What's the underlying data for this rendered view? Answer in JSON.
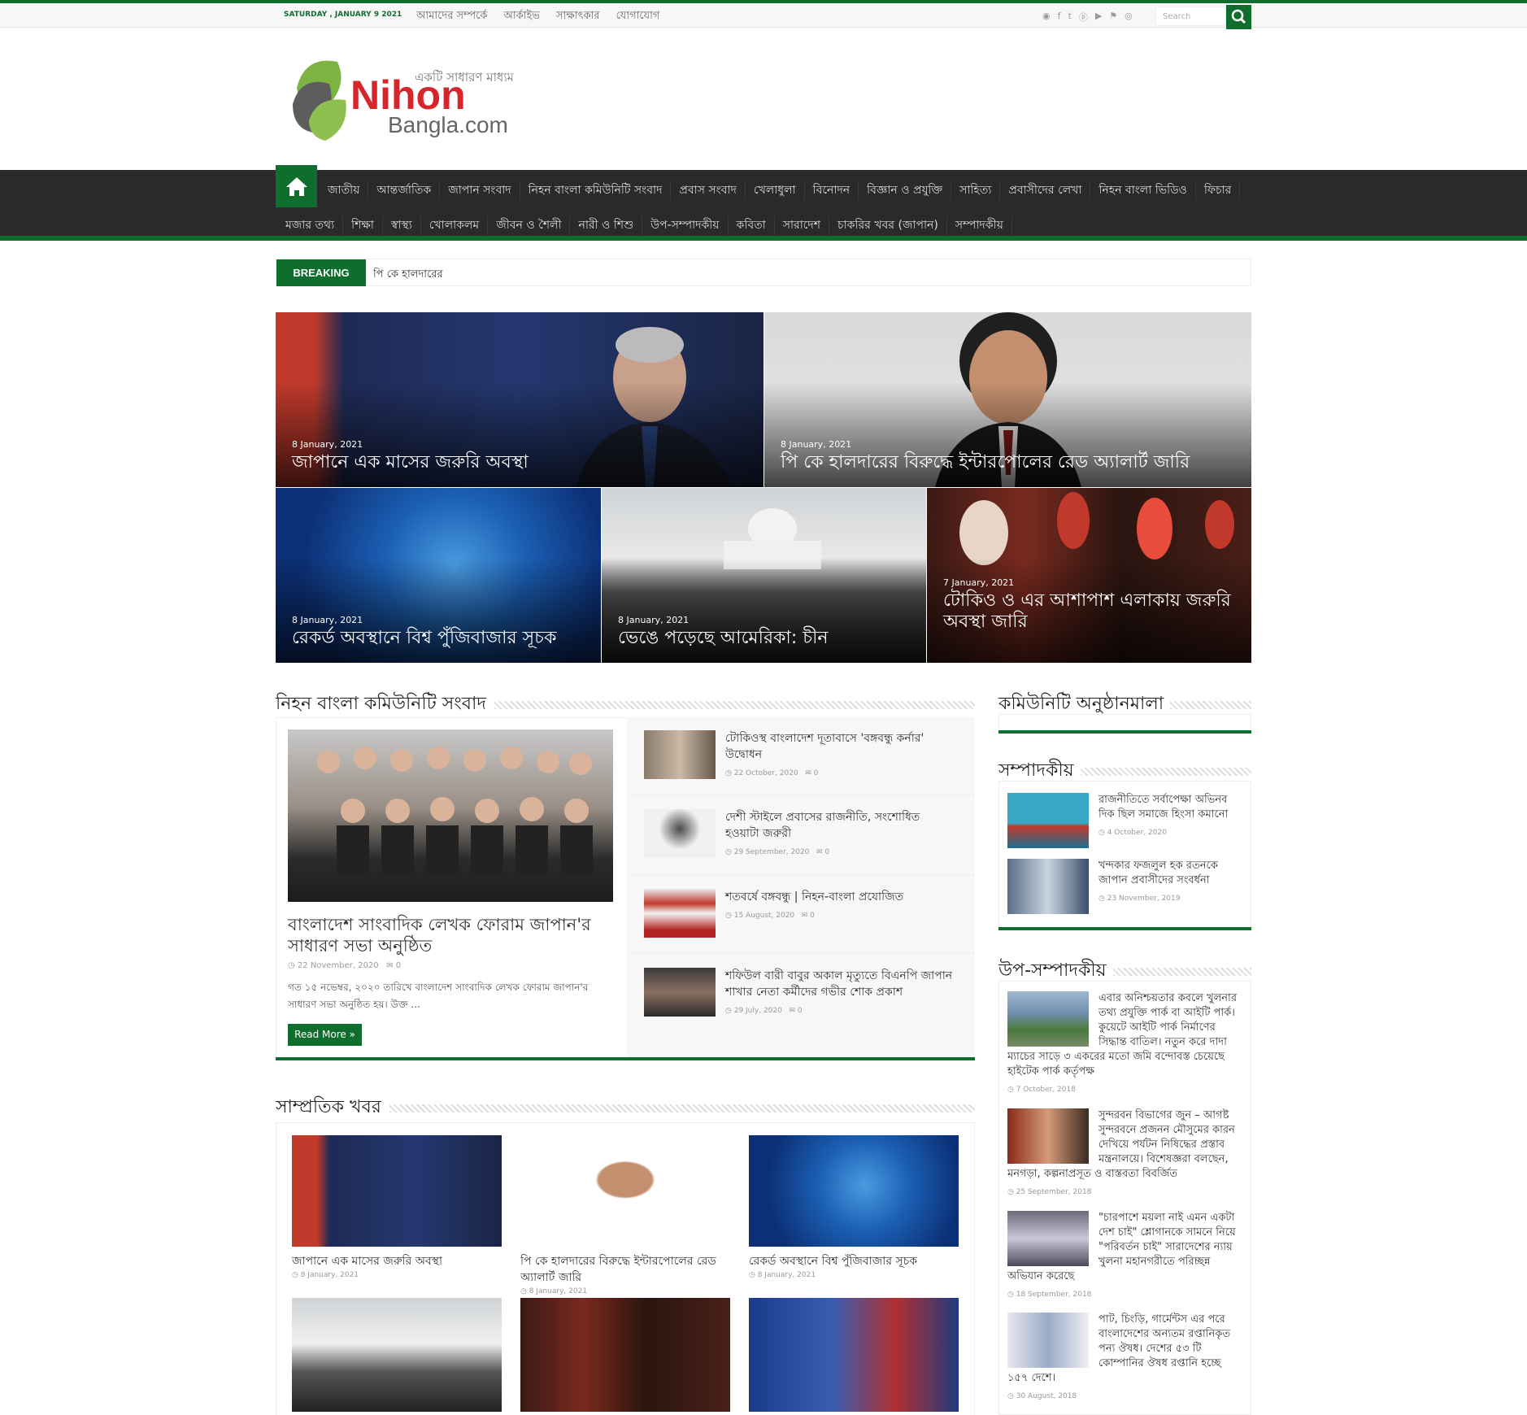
{
  "topbar": {
    "date": "SATURDAY , JANUARY 9 2021",
    "links": [
      "আমাদের সম্পর্কে",
      "আর্কাইভ",
      "সাক্ষাৎকার",
      "যোগাযোগ"
    ],
    "social_icons": [
      "rss-icon",
      "facebook-icon",
      "twitter-icon",
      "pinterest-icon",
      "youtube-icon",
      "foursquare-icon",
      "instagram-icon"
    ],
    "search_placeholder": "Search"
  },
  "logo": {
    "tagline": "একটি সাধারণ মাধ্যম",
    "name_main": "Nihon",
    "name_sub": "Bangla.com"
  },
  "nav": {
    "row1": [
      "জাতীয়",
      "আন্তর্জাতিক",
      "জাপান সংবাদ",
      "নিহন বাংলা কমিউনিটি সংবাদ",
      "প্রবাস সংবাদ",
      "খেলাধুলা",
      "বিনোদন",
      "বিজ্ঞান ও প্রযুক্তি",
      "সাহিত্য",
      "প্রবাসীদের লেখা",
      "নিহন বাংলা ভিডিও",
      "ফিচার"
    ],
    "row2": [
      "মজার তথ্য",
      "শিক্ষা",
      "স্বাস্থ্য",
      "খোলাকলম",
      "জীবন ও শৈলী",
      "নারী ও শিশু",
      "উপ-সম্পাদকীয়",
      "কবিতা",
      "সারাদেশ",
      "চাকরির খবর (জাপান)",
      "সম্পাদকীয়"
    ]
  },
  "breaking": {
    "label": "BREAKING NEWS",
    "text": "পি কে হালদারের"
  },
  "slider": [
    {
      "date": "8 January, 2021",
      "title": "জাপানে এক মাসের জরুরি অবস্থা"
    },
    {
      "date": "8 January, 2021",
      "title": "পি কে হালদারের বিরুদ্ধে ইন্টারপোলের রেড অ্যালার্ট জারি"
    },
    {
      "date": "8 January, 2021",
      "title": "রেকর্ড অবস্থানে বিশ্ব পুঁজিবাজার সূচক"
    },
    {
      "date": "8 January, 2021",
      "title": "ভেঙে পড়েছে আমেরিকা: চীন"
    },
    {
      "date": "7 January, 2021",
      "title": "টোকিও ও এর আশাপাশ এলাকায় জরুরি অবস্থা জারি"
    }
  ],
  "community": {
    "heading": "নিহন বাংলা কমিউনিটি সংবাদ",
    "main": {
      "title": "বাংলাদেশ সাংবাদিক লেখক ফোরাম জাপান'র সাধারণ সভা অনুষ্ঠিত",
      "date": "22 November, 2020",
      "comments": "0",
      "excerpt": "গত ১৫ নভেম্বর, ২০২০ তারিখে বাংলাদেশ সাংবাদিক লেখক ফোরাম জাপান'র সাধারণ সভা অনুষ্ঠিত হয়। উক্ত ...",
      "read_more": "Read More »"
    },
    "items": [
      {
        "title": "টোকিওস্থ বাংলাদেশ দূতাবাসে 'বঙ্গবন্ধু কর্নার' উদ্বোধন",
        "date": "22 October, 2020",
        "comments": "0"
      },
      {
        "title": "দেশী স্টাইলে প্রবাসের রাজনীতি, সংশোধিত হওয়াটা জরুরী",
        "date": "29 September, 2020",
        "comments": "0"
      },
      {
        "title": "শতবর্ষে বঙ্গবন্ধু | নিহন-বাংলা প্রযোজিত",
        "date": "15 August, 2020",
        "comments": "0"
      },
      {
        "title": "শফিউল বারী বাবুর অকাল মৃত্যুতে বিএনপি জাপান শাখার নেতা কর্মীদের গভীর শোক প্রকাশ",
        "date": "29 July, 2020",
        "comments": "0"
      }
    ]
  },
  "recent": {
    "heading": "সাম্প্রতিক খবর",
    "items": [
      {
        "title": "জাপানে এক মাসের জরুরি অবস্থা",
        "date": "8 January, 2021"
      },
      {
        "title": "পি কে হালদারের বিরুদ্ধে ইন্টারপোলের রেড অ্যালার্ট জারি",
        "date": "8 January, 2021"
      },
      {
        "title": "রেকর্ড অবস্থানে বিশ্ব পুঁজিবাজার সূচক",
        "date": "8 January, 2021"
      }
    ]
  },
  "sidebar": {
    "events_heading": "কমিউনিটি অনুষ্ঠানমালা",
    "editorial_heading": "সম্পাদকীয়",
    "editorial": [
      {
        "title": "রাজনীতিতে সর্বাপেক্ষা অভিনব দিক ছিল সমাজে হিংসা কমানো",
        "date": "4 October, 2020"
      },
      {
        "title": "খন্দকার ফজলুল হক রতনকে জাপান প্রবাসীদের সংবর্ধনা",
        "date": "23 November, 2019"
      }
    ],
    "op_heading": "উপ-সম্পাদকীয়",
    "op": [
      {
        "title": "এবার অনিশ্চয়তার কবলে খুলনার তথ্য প্রযুক্তি পার্ক বা আইটি পার্ক। কুয়েটে আইটি পার্ক নির্মাণের সিদ্ধান্ত বাতিল। নতুন করে দাদা ম্যাচের সাড়ে ৩ একরের মতো জমি বন্দোবস্ত চেয়েছে হাইটেক পার্ক কর্তৃপক্ষ",
        "date": "7 October, 2018"
      },
      {
        "title": "সুন্দরবন বিভাগের জুন – আগষ্ট সুন্দরবনে প্রজনন মৌসুমের কারন দেখিয়ে পর্যটন নিষিদ্ধের প্রস্তাব মন্ত্রনালয়ে। বিশেষজ্ঞরা বলছেন, মনগড়া, কল্পনাপ্রসূত ও বাস্তবতা বিবর্জিত",
        "date": "25 September, 2018"
      },
      {
        "title": "\"চারপাশে ময়লা নাই এমন একটা দেশ চাই\" শ্লোগানকে সামনে নিয়ে \"পরিবর্তন চাই\" সারাদেশের ন্যায় খুলনা মহানগরীতে পরিচ্ছন্ন অভিযান করেছে",
        "date": "18 September, 2018"
      },
      {
        "title": "পাট, চিংড়ি, গার্মেন্টস এর পরে বাংলাদেশের অন্যতম রপ্তানিকৃত পন্য ঔষধ। দেশের ৫৩ টি কোম্পানির ঔষধ রপ্তানি হচ্ছে ১৫৭ দেশে।",
        "date": "30 August, 2018"
      }
    ]
  },
  "colors": {
    "brand": "#0f6e2e",
    "nav_bg": "#2a2a2a",
    "logo_red": "#d7262b"
  }
}
